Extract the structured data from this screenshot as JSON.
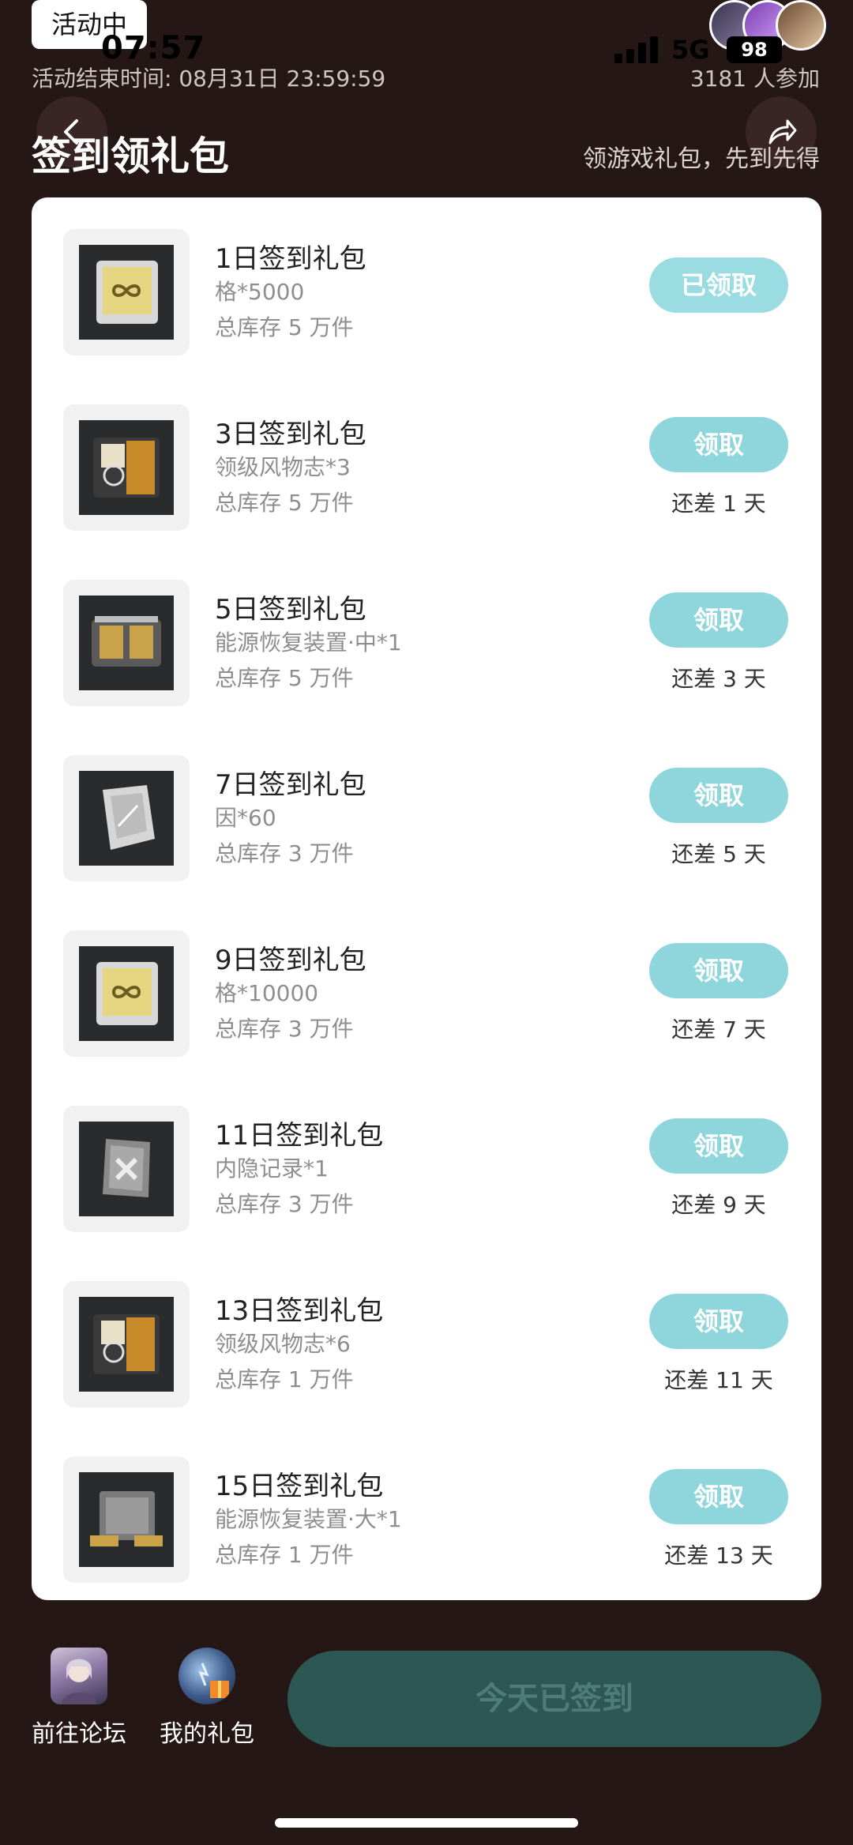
{
  "status": {
    "badge": "活动中",
    "time": "07:57",
    "network": "5G",
    "battery": "98"
  },
  "header": {
    "end_time": "活动结束时间: 08月31日 23:59:59",
    "participants": "3181 人参加",
    "title": "签到领礼包",
    "subtitle": "领游戏礼包，先到先得"
  },
  "gifts": [
    {
      "name": "1日签到礼包",
      "item": "格*5000",
      "stock": "总库存 5 万件",
      "button": "已领取",
      "remaining": "",
      "icon": "infinity-chip-icon"
    },
    {
      "name": "3日签到礼包",
      "item": "领级风物志*3",
      "stock": "总库存 5 万件",
      "button": "领取",
      "remaining": "还差 1 天",
      "icon": "book-case-icon"
    },
    {
      "name": "5日签到礼包",
      "item": "能源恢复装置·中*1",
      "stock": "总库存 5 万件",
      "button": "领取",
      "remaining": "还差 3 天",
      "icon": "energy-box-medium-icon"
    },
    {
      "name": "7日签到礼包",
      "item": "因*60",
      "stock": "总库存 3 万件",
      "button": "领取",
      "remaining": "还差 5 天",
      "icon": "card-shard-icon"
    },
    {
      "name": "9日签到礼包",
      "item": "格*10000",
      "stock": "总库存 3 万件",
      "button": "领取",
      "remaining": "还差 7 天",
      "icon": "infinity-chip-icon"
    },
    {
      "name": "11日签到礼包",
      "item": "内隐记录*1",
      "stock": "总库存 3 万件",
      "button": "领取",
      "remaining": "还差 9 天",
      "icon": "record-tag-icon"
    },
    {
      "name": "13日签到礼包",
      "item": "领级风物志*6",
      "stock": "总库存 1 万件",
      "button": "领取",
      "remaining": "还差 11 天",
      "icon": "book-case-icon"
    },
    {
      "name": "15日签到礼包",
      "item": "能源恢复装置·大*1",
      "stock": "总库存 1 万件",
      "button": "领取",
      "remaining": "还差 13 天",
      "icon": "energy-box-large-icon"
    }
  ],
  "bottom": {
    "forum_label": "前往论坛",
    "mygifts_label": "我的礼包",
    "checkin_label": "今天已签到"
  },
  "colors": {
    "background": "#241716",
    "accent": "#8fd6dc",
    "checkin_button": "#2d5753"
  }
}
